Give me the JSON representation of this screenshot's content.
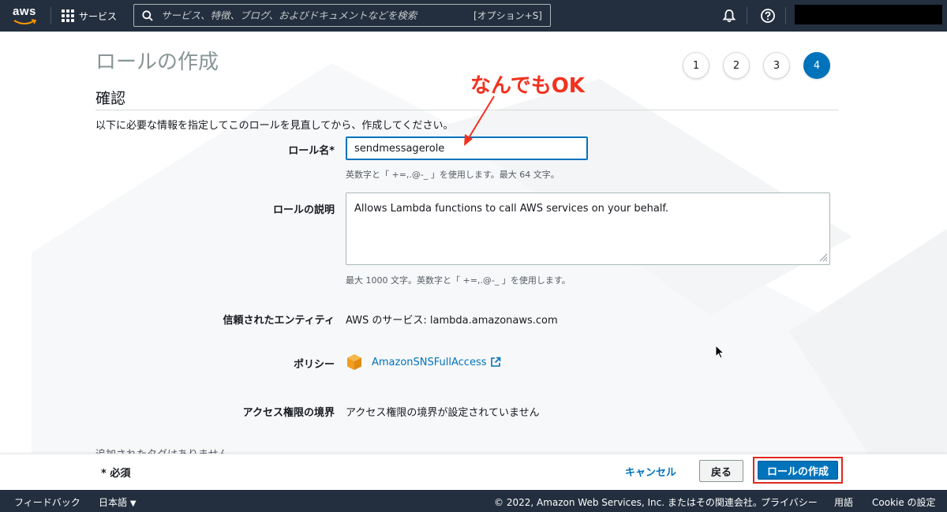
{
  "topnav": {
    "logo_text": "aws",
    "services_label": "サービス",
    "search_placeholder": "サービス、特徴、ブログ、およびドキュメントなどを検索",
    "search_shortcut": "[オプション+S]"
  },
  "page": {
    "title": "ロールの作成",
    "steps": [
      "1",
      "2",
      "3",
      "4"
    ],
    "active_step": "4",
    "section_title": "確認",
    "intro": "以下に必要な情報を指定してこのロールを見直してから、作成してください。"
  },
  "form": {
    "role_name_label": "ロール名*",
    "role_name_value": "sendmessagerole",
    "role_name_hint": "英数字と「 +=,.@-_ 」を使用します。最大 64 文字。",
    "description_label": "ロールの説明",
    "description_value": "Allows Lambda functions to call AWS services on your behalf.",
    "description_hint": "最大 1000 文字。英数字と「 +=,.@-_ 」を使用します。",
    "trusted_label": "信頼されたエンティティ",
    "trusted_value": "AWS のサービス: lambda.amazonaws.com",
    "policy_label": "ポリシー",
    "policy_link": "AmazonSNSFullAccess",
    "boundary_label": "アクセス権限の境界",
    "boundary_value": "アクセス権限の境界が設定されていません",
    "tags_note": "追加されたタグはありません。"
  },
  "annotation": {
    "text": "なんでもOK",
    "color": "#f2311f"
  },
  "actions": {
    "required_note": "* 必須",
    "cancel_label": "キャンセル",
    "back_label": "戻る",
    "create_label": "ロールの作成"
  },
  "footer": {
    "feedback": "フィードバック",
    "language": "日本語",
    "copyright": "© 2022, Amazon Web Services, Inc. またはその関連会社。",
    "privacy": "プライバシー",
    "terms": "用語",
    "cookie": "Cookie の設定"
  },
  "colors": {
    "nav_bg": "#232f3e",
    "accent": "#0073bb",
    "highlight_border": "#e0281f"
  }
}
